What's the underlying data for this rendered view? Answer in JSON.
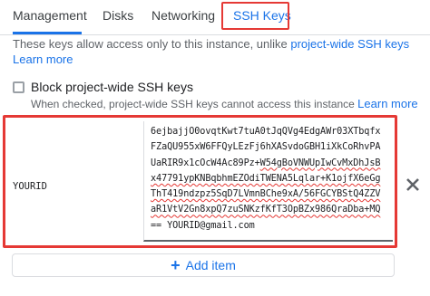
{
  "tabs": [
    {
      "label": "Management"
    },
    {
      "label": "Disks"
    },
    {
      "label": "Networking"
    },
    {
      "label": "SSH Keys"
    }
  ],
  "description": {
    "text": "These keys allow access only to this instance, unlike ",
    "link": "project-wide SSH keys",
    "learn_more": "Learn more"
  },
  "block_checkbox": {
    "label": "Block project-wide SSH keys",
    "checked": false,
    "help": "When checked, project-wide SSH keys cannot access this instance ",
    "help_link": "Learn more"
  },
  "ssh_key": {
    "username": "YOURID",
    "lines": [
      "6ejbajjO0ovqtKwt7tuA0tJqQVg4EdgAWr03XTbqfx",
      "FZaQU955xW6FFQyLEzFj6hXASvdoGBH1iXkCoRhvPA",
      "UaRIR9x1cOcW4Ac89Pz+W54gBoVNWUpIwCvMxDhJsB",
      "x47791ypKNBqbhmEZOdiTWENA5Lqlar+K1ojfX6eGg",
      "ThT419ndzpz5SqD7LVmnBChe9xA/56FGCYBStQ4ZZV",
      "aR1VtV2Gn8xpQ7zuSNKzfKfT3OpBZx986QraDba+MQ",
      "== YOURID@gmail.com"
    ]
  },
  "add_button": {
    "label": "Add item"
  },
  "colors": {
    "accent": "#1a73e8",
    "highlight": "#e53935"
  }
}
